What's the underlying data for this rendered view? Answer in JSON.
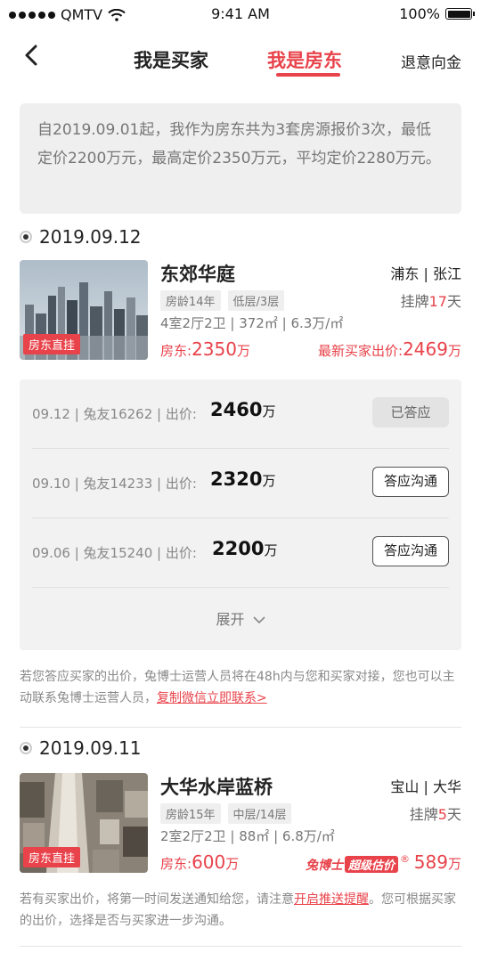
{
  "status_bar": {
    "carrier": "QMTV",
    "time": "9:41 AM",
    "battery": "100%",
    "battery_level": 1.0
  },
  "nav": {
    "tab_buyer": "我是买家",
    "tab_landlord": "我是房东",
    "refund": "退意向金"
  },
  "summary": {
    "text": "自2019.09.01起，我作为房东共为3套房源报价3次，最低定价2200万元，最高定价2350万元，平均定价2280万元。"
  },
  "groups": [
    {
      "date": "2019.09.12",
      "listing": {
        "name": "东郊华庭",
        "district": "浦东 | 张江",
        "tags": [
          "房龄14年",
          "低层/3层"
        ],
        "listed_prefix": "挂牌",
        "listed_days": "17",
        "listed_suffix": "天",
        "spec": "4室2厅2卫 | 372㎡ | 6.3万/㎡",
        "photo_tag": "房东直挂",
        "price_label": "房东:",
        "price_value": "2350",
        "price_unit": "万",
        "right_label": "最新买家出价:",
        "right_value": "2469",
        "right_unit": "万"
      },
      "offers": [
        {
          "meta": "09.12 | 兔友16262 | 出价:",
          "amount": "2460",
          "unit": "万",
          "action": "已答应",
          "answered": true
        },
        {
          "meta": "09.10 | 兔友14233 | 出价:",
          "amount": "2320",
          "unit": "万",
          "action": "答应沟通",
          "answered": false
        },
        {
          "meta": "09.06 | 兔友15240 | 出价:",
          "amount": "2200",
          "unit": "万",
          "action": "答应沟通",
          "answered": false
        }
      ],
      "expand_label": "展开",
      "notice_text": "若您答应买家的出价，兔博士运营人员将在48h内与您和买家对接，您也可以主动联系兔博士运营人员，",
      "notice_link": "复制微信立即联系>"
    },
    {
      "date": "2019.09.11",
      "listing": {
        "name": "大华水岸蓝桥",
        "district": "宝山 | 大华",
        "tags": [
          "房龄15年",
          "中层/14层"
        ],
        "listed_prefix": "挂牌",
        "listed_days": "5",
        "listed_suffix": "天",
        "spec": "2室2厅2卫 | 88㎡ | 6.8万/㎡",
        "photo_tag": "房东直挂",
        "price_label": "房东:",
        "price_value": "600",
        "price_unit": "万",
        "badge_brand": "兔博士",
        "badge_name": "超级估价",
        "badge_mark": "®",
        "right_value": "589",
        "right_unit": "万"
      },
      "notice_text_a": "若有买家出价，将第一时间发送通知给您，请注意",
      "notice_link": "开启推送提醒",
      "notice_text_b": "。您可根据买家的出价，选择是否与买家进一步沟通。"
    }
  ],
  "colors": {
    "accent": "#e8424a",
    "muted": "#888888"
  }
}
